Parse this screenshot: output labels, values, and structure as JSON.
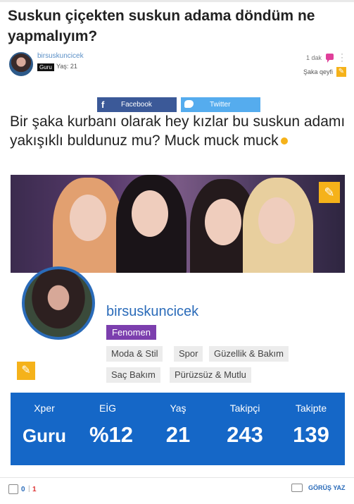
{
  "question": {
    "title": "Suskun çiçekten suskun adama döndüm ne yapmalıyım?",
    "author": "birsuskuncicek",
    "level_badge": "Guru",
    "age_text": "Yaş: 21",
    "time_ago": "1 dak",
    "category": "Şaka qeyfi",
    "body": "Bir şaka kurbanı olarak hey kızlar bu suskun adamı yakışıklı buldunuz mu? Muck muck muck"
  },
  "share": {
    "facebook_label": "Facebook",
    "twitter_label": "Twitter"
  },
  "profile_card": {
    "name": "birsuskuncicek",
    "badge": "Fenomen",
    "tags": [
      "Moda & Stil",
      "Spor",
      "Güzellik & Bakım",
      "Saç Bakım",
      "Pürüzsüz & Mutlu"
    ],
    "stats": [
      {
        "label": "Xper",
        "value": "Guru"
      },
      {
        "label": "EİG",
        "value": "%12"
      },
      {
        "label": "Yaş",
        "value": "21"
      },
      {
        "label": "Takipçi",
        "value": "243"
      },
      {
        "label": "Takipte",
        "value": "139"
      }
    ]
  },
  "footer": {
    "likes": "0",
    "separator": "|",
    "dislikes": "1",
    "comment_label": "GÖRÜŞ YAZ"
  },
  "colors": {
    "accent_blue": "#1567c7",
    "fenomen_purple": "#7c3fae",
    "edit_yellow": "#f5b21a",
    "facebook": "#3b5998",
    "twitter": "#55acee"
  },
  "icons": [
    "pink-chat-icon",
    "more-dots-icon",
    "pencil-icon",
    "facebook-icon",
    "twitter-icon",
    "emoji-icon",
    "thumbs-up-icon",
    "comment-icon"
  ]
}
